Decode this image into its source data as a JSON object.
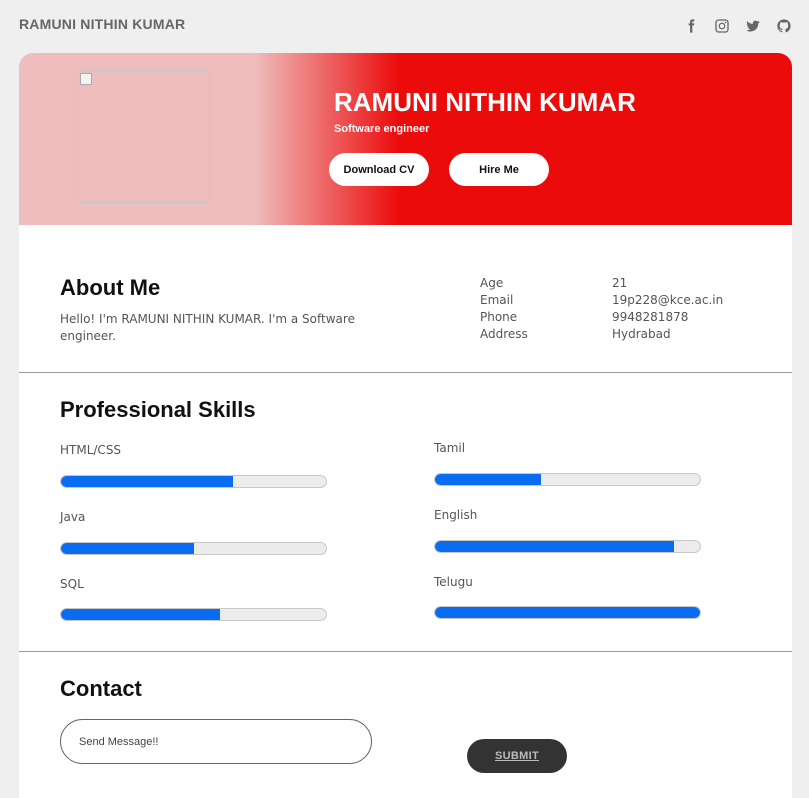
{
  "topbar": {
    "brand": "RAMUNI NITHIN KUMAR",
    "social_icons": [
      "facebook-icon",
      "instagram-icon",
      "twitter-icon",
      "github-icon"
    ]
  },
  "hero": {
    "name": "RAMUNI NITHIN KUMAR",
    "role": "Software engineer",
    "download_cv": "Download CV",
    "hire_me": "Hire Me",
    "accent_color": "#ec0b0b",
    "light_color": "#efbdbd"
  },
  "about": {
    "title": "About Me",
    "text": "Hello! I'm RAMUNI NITHIN KUMAR. I'm a Software engineer.",
    "info": [
      {
        "label": "Age",
        "value": "21"
      },
      {
        "label": "Email",
        "value": "19p228@kce.ac.in"
      },
      {
        "label": "Phone",
        "value": "9948281878"
      },
      {
        "label": "Address",
        "value": "Hydrabad"
      }
    ]
  },
  "skills": {
    "title": "Professional Skills",
    "fill_color": "#0a6cf0",
    "items": [
      {
        "name": "HTML/CSS",
        "level": 0.65
      },
      {
        "name": "Java",
        "level": 0.5
      },
      {
        "name": "SQL",
        "level": 0.6
      },
      {
        "name": "Tamil",
        "level": 0.4
      },
      {
        "name": "English",
        "level": 0.9
      },
      {
        "name": "Telugu",
        "level": 1.0
      }
    ]
  },
  "contact": {
    "title": "Contact",
    "placeholder": "Send Message!!",
    "submit": "SUBMIT"
  }
}
